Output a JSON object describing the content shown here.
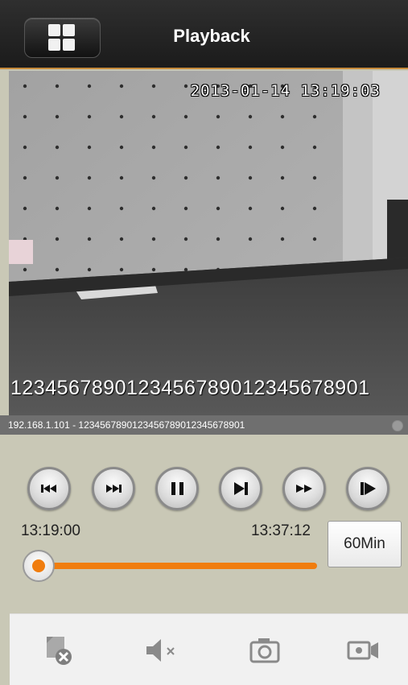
{
  "header": {
    "title": "Playback",
    "menu_icon": "grid-icon"
  },
  "video": {
    "timestamp": "2013-01-14 13:19:03",
    "caption": "1234567890123456789012345678901"
  },
  "info_bar": {
    "text": "192.168.1.101 - 1234567890123456789012345678901"
  },
  "controls": {
    "buttons": [
      {
        "name": "skip-back-icon"
      },
      {
        "name": "skip-forward-icon"
      },
      {
        "name": "pause-icon"
      },
      {
        "name": "step-forward-icon"
      },
      {
        "name": "fast-forward-icon"
      },
      {
        "name": "slow-play-icon"
      }
    ],
    "time_start": "13:19:00",
    "time_end": "13:37:12",
    "range_label": "60Min",
    "progress": 0.0
  },
  "toolbar": {
    "items": [
      {
        "name": "close-playback-icon"
      },
      {
        "name": "mute-icon"
      },
      {
        "name": "snapshot-icon"
      },
      {
        "name": "record-icon"
      }
    ]
  },
  "colors": {
    "accent": "#f07d0f",
    "header_bg": "#1b1b1b",
    "panel_bg": "#c9c8b6"
  }
}
